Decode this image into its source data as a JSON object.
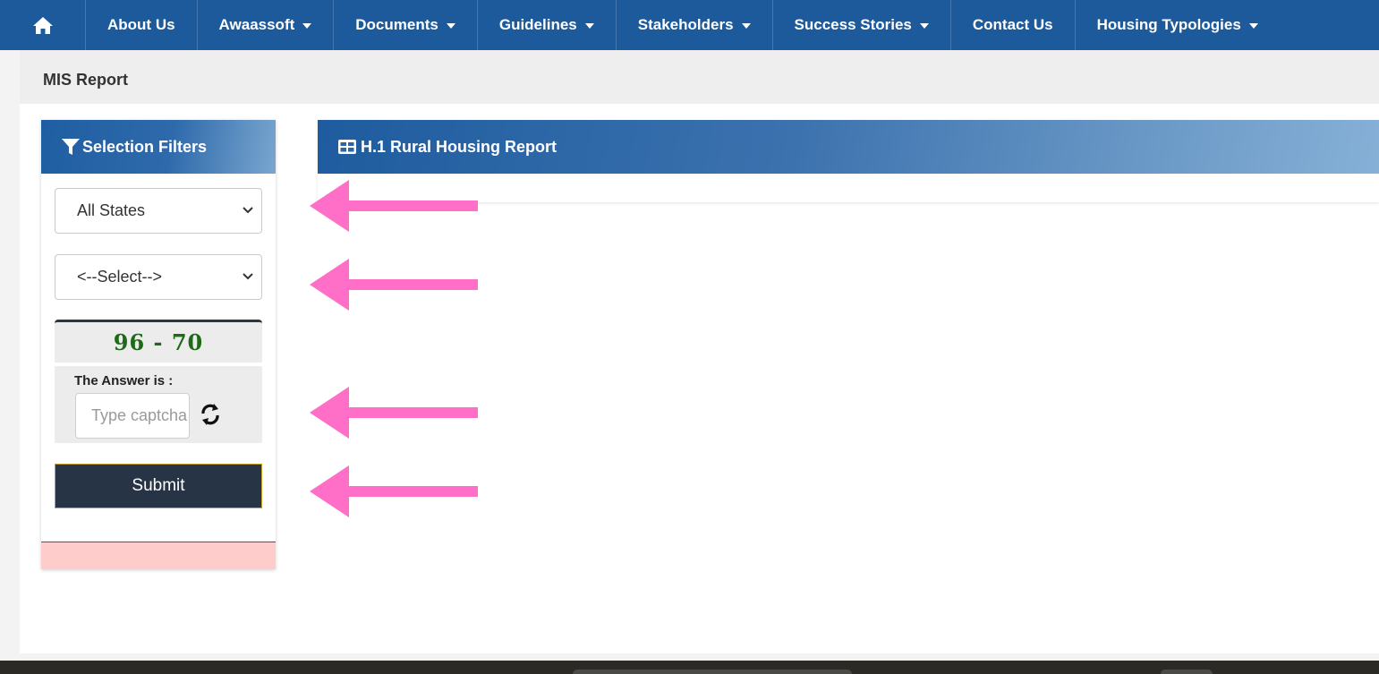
{
  "nav": {
    "items": [
      {
        "label": "About Us",
        "dropdown": false
      },
      {
        "label": "Awaassoft",
        "dropdown": true
      },
      {
        "label": "Documents",
        "dropdown": true
      },
      {
        "label": "Guidelines",
        "dropdown": true
      },
      {
        "label": "Stakeholders",
        "dropdown": true
      },
      {
        "label": "Success Stories",
        "dropdown": true
      },
      {
        "label": "Contact Us",
        "dropdown": false
      },
      {
        "label": "Housing Typologies",
        "dropdown": true
      }
    ]
  },
  "page": {
    "breadcrumb": "MIS Report"
  },
  "filters": {
    "title": "Selection Filters",
    "state_select": "All States",
    "second_select": "<--Select-->",
    "captcha_code": "96 - 70",
    "answer_label": "The Answer is :",
    "captcha_placeholder": "Type captcha",
    "submit_label": "Submit"
  },
  "report": {
    "title": "H.1 Rural Housing Report"
  },
  "colors": {
    "nav_bg": "#1c5a9c",
    "submit_bg": "#263446",
    "arrow": "#ff6ec7",
    "captcha_text": "#1d6b18",
    "footer_bar": "#ffcccc"
  }
}
